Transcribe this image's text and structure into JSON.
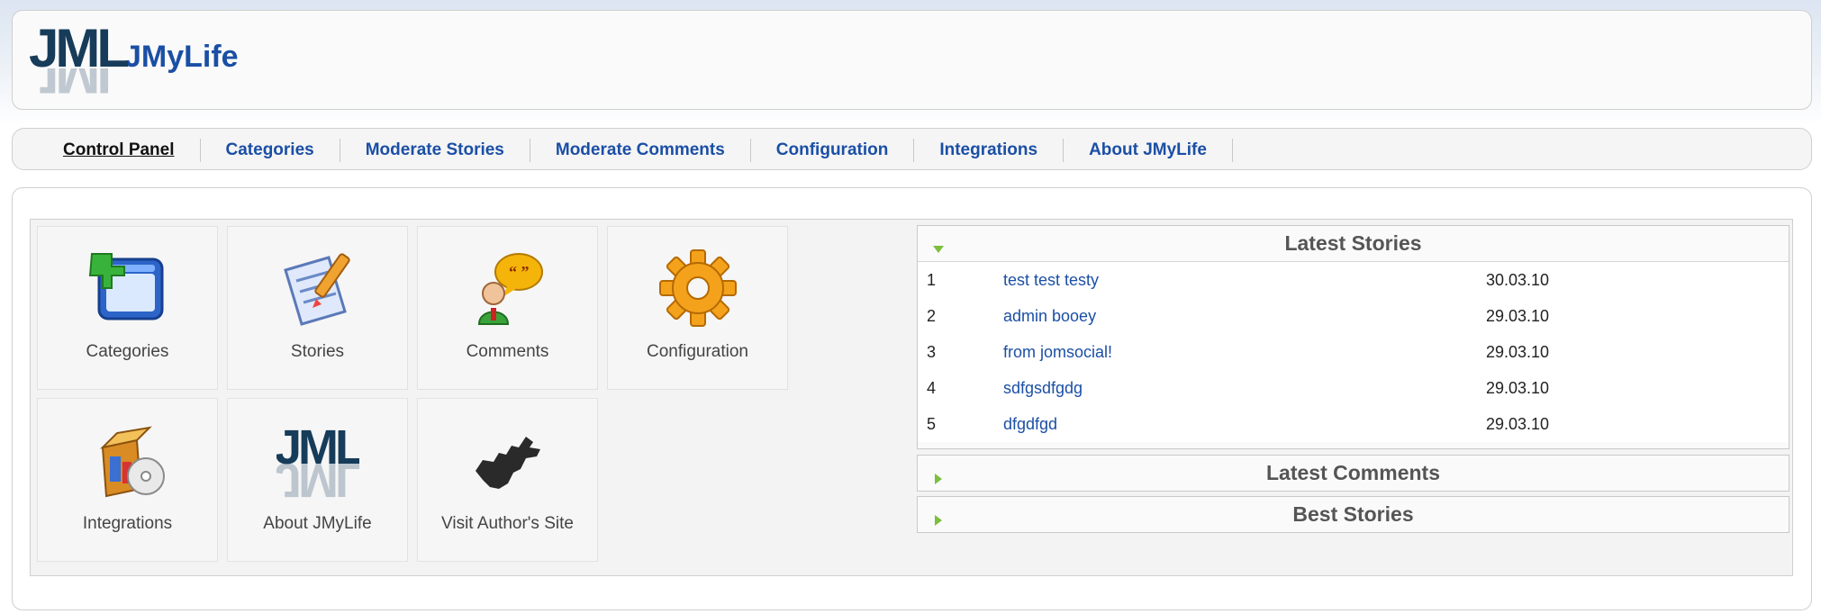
{
  "app": {
    "name": "JMyLife",
    "logo_text": "JML"
  },
  "nav": {
    "items": [
      "Control Panel",
      "Categories",
      "Moderate Stories",
      "Moderate Comments",
      "Configuration",
      "Integrations",
      "About JMyLife"
    ]
  },
  "tiles": [
    {
      "label": "Categories",
      "icon": "categories-icon"
    },
    {
      "label": "Stories",
      "icon": "stories-icon"
    },
    {
      "label": "Comments",
      "icon": "comments-icon"
    },
    {
      "label": "Configuration",
      "icon": "configuration-icon"
    },
    {
      "label": "Integrations",
      "icon": "integrations-icon"
    },
    {
      "label": "About JMyLife",
      "icon": "about-logo-icon"
    },
    {
      "label": "Visit Author's Site",
      "icon": "map-silhouette-icon"
    }
  ],
  "latest_stories": {
    "title": "Latest Stories",
    "rows": [
      {
        "num": "1",
        "title": "test test testy",
        "date": "30.03.10"
      },
      {
        "num": "2",
        "title": "admin booey",
        "date": "29.03.10"
      },
      {
        "num": "3",
        "title": "from jomsocial!",
        "date": "29.03.10"
      },
      {
        "num": "4",
        "title": "sdfgsdfgdg",
        "date": "29.03.10"
      },
      {
        "num": "5",
        "title": "dfgdfgd",
        "date": "29.03.10"
      }
    ]
  },
  "latest_comments": {
    "title": "Latest Comments"
  },
  "best_stories": {
    "title": "Best Stories"
  },
  "colors": {
    "link": "#1b4fa5",
    "accent_arrow": "#7cbf3c"
  }
}
